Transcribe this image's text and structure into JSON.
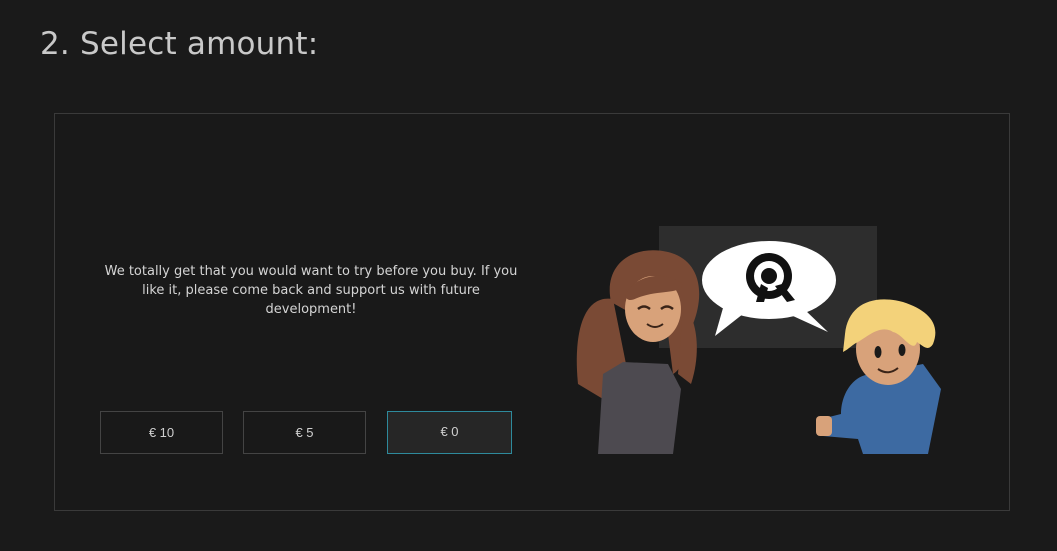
{
  "header": {
    "title": "2. Select amount:"
  },
  "panel": {
    "message": "We totally get that you would want to try before you buy. If you like it, please come back and support us with future development!",
    "amounts": [
      {
        "label": "€ 10",
        "selected": false
      },
      {
        "label": "€ 5",
        "selected": false
      },
      {
        "label": "€ 0",
        "selected": true
      }
    ]
  },
  "colors": {
    "background": "#1a1a1a",
    "selected_border": "#2e8a9c",
    "text": "#d4d4d4"
  },
  "illustration": {
    "icons": [
      "speech-bubble-logo-icon",
      "girl-character",
      "boy-character"
    ]
  }
}
